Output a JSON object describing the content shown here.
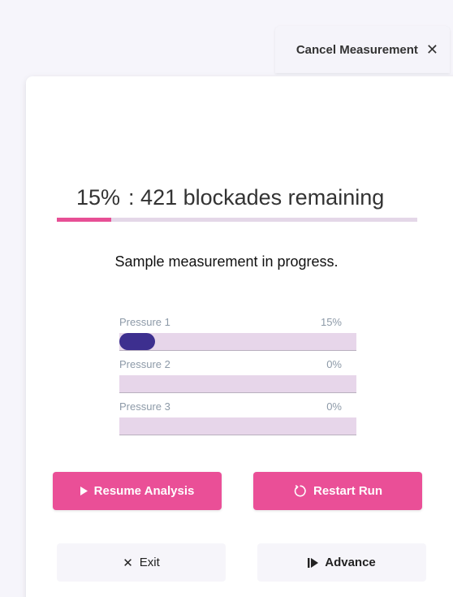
{
  "cancel_tab": {
    "label": "Cancel Measurement",
    "icon": "close-icon"
  },
  "progress": {
    "percent_label": "15%",
    "remaining_label": ": 421 blockades remaining",
    "value": 0.15,
    "color": "#e74f95"
  },
  "status_text": "Sample measurement in progress.",
  "pressures": [
    {
      "label": "Pressure 1",
      "value_label": "15%",
      "value": 0.15
    },
    {
      "label": "Pressure 2",
      "value_label": "0%",
      "value": 0
    },
    {
      "label": "Pressure 3",
      "value_label": "0%",
      "value": 0
    }
  ],
  "buttons": {
    "resume": {
      "label": "Resume Analysis",
      "icon": "play-icon"
    },
    "restart": {
      "label": "Restart Run",
      "icon": "restart-icon"
    },
    "exit": {
      "label": "Exit",
      "icon": "close-icon"
    },
    "advance": {
      "label": "Advance",
      "icon": "skip-forward-icon"
    }
  },
  "colors": {
    "accent": "#ea4f97",
    "pressure_fill": "#3d2f8f",
    "track": "#e7d6ea"
  }
}
